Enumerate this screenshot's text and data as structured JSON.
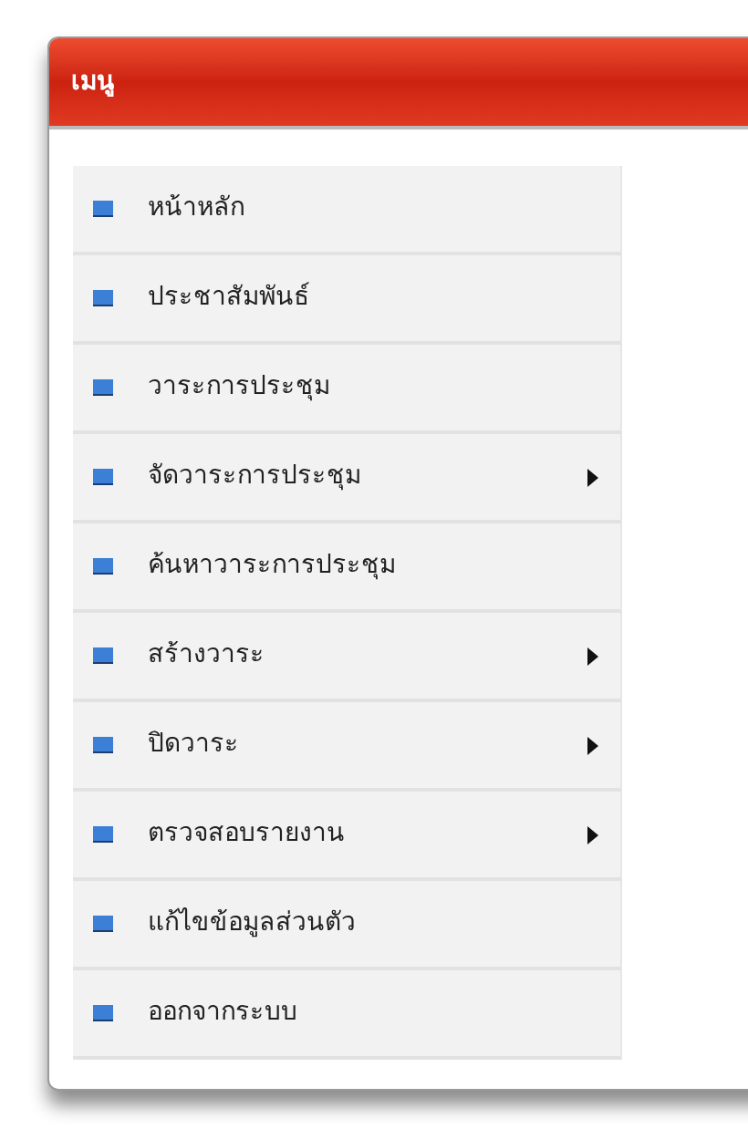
{
  "menu": {
    "title": "เมนู",
    "items": [
      {
        "label": "หน้าหลัก",
        "submenu": false
      },
      {
        "label": "ประชาสัมพันธ์",
        "submenu": false
      },
      {
        "label": "วาระการประชุม",
        "submenu": false
      },
      {
        "label": "จัดวาระการประชุม",
        "submenu": true
      },
      {
        "label": "ค้นหาวาระการประชุม",
        "submenu": false
      },
      {
        "label": "สร้างวาระ",
        "submenu": true
      },
      {
        "label": "ปิดวาระ",
        "submenu": true
      },
      {
        "label": "ตรวจสอบรายงาน",
        "submenu": true
      },
      {
        "label": "แก้ไขข้อมูลส่วนตัว",
        "submenu": false
      },
      {
        "label": "ออกจากระบบ",
        "submenu": false
      }
    ]
  }
}
